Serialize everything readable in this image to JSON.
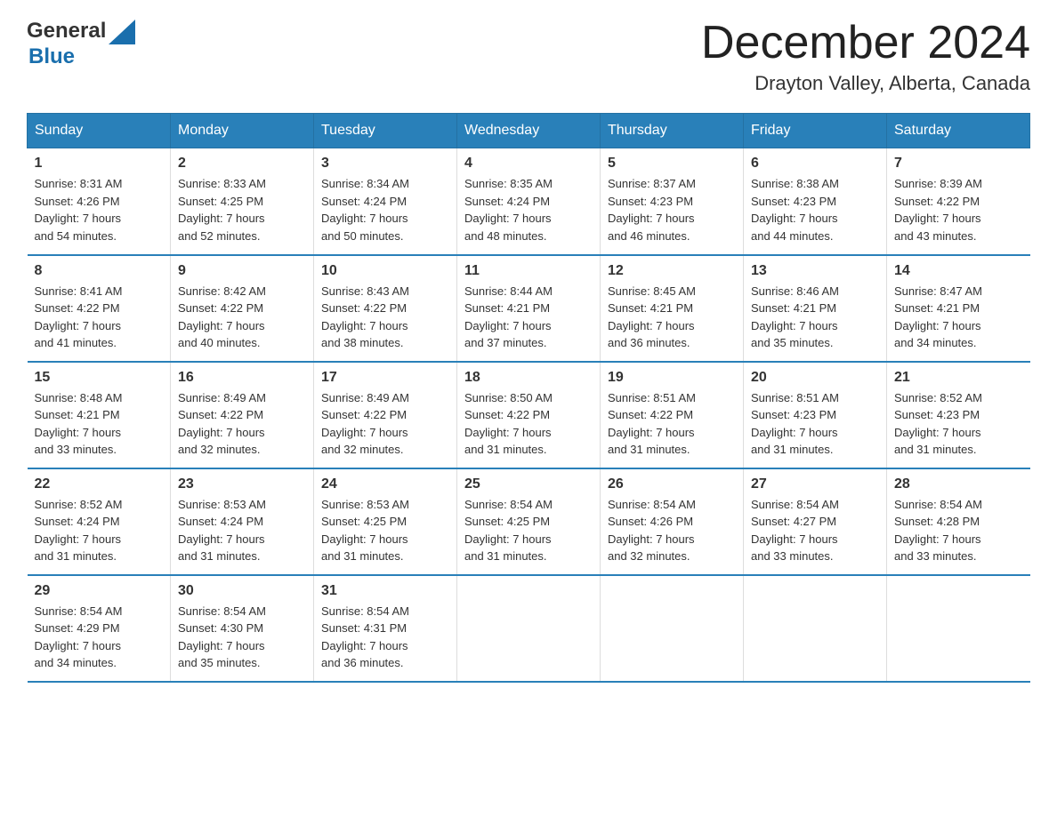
{
  "header": {
    "logo_general": "General",
    "logo_blue": "Blue",
    "month_title": "December 2024",
    "location": "Drayton Valley, Alberta, Canada"
  },
  "weekdays": [
    "Sunday",
    "Monday",
    "Tuesday",
    "Wednesday",
    "Thursday",
    "Friday",
    "Saturday"
  ],
  "weeks": [
    [
      {
        "day": "1",
        "sunrise": "8:31 AM",
        "sunset": "4:26 PM",
        "daylight": "7 hours and 54 minutes."
      },
      {
        "day": "2",
        "sunrise": "8:33 AM",
        "sunset": "4:25 PM",
        "daylight": "7 hours and 52 minutes."
      },
      {
        "day": "3",
        "sunrise": "8:34 AM",
        "sunset": "4:24 PM",
        "daylight": "7 hours and 50 minutes."
      },
      {
        "day": "4",
        "sunrise": "8:35 AM",
        "sunset": "4:24 PM",
        "daylight": "7 hours and 48 minutes."
      },
      {
        "day": "5",
        "sunrise": "8:37 AM",
        "sunset": "4:23 PM",
        "daylight": "7 hours and 46 minutes."
      },
      {
        "day": "6",
        "sunrise": "8:38 AM",
        "sunset": "4:23 PM",
        "daylight": "7 hours and 44 minutes."
      },
      {
        "day": "7",
        "sunrise": "8:39 AM",
        "sunset": "4:22 PM",
        "daylight": "7 hours and 43 minutes."
      }
    ],
    [
      {
        "day": "8",
        "sunrise": "8:41 AM",
        "sunset": "4:22 PM",
        "daylight": "7 hours and 41 minutes."
      },
      {
        "day": "9",
        "sunrise": "8:42 AM",
        "sunset": "4:22 PM",
        "daylight": "7 hours and 40 minutes."
      },
      {
        "day": "10",
        "sunrise": "8:43 AM",
        "sunset": "4:22 PM",
        "daylight": "7 hours and 38 minutes."
      },
      {
        "day": "11",
        "sunrise": "8:44 AM",
        "sunset": "4:21 PM",
        "daylight": "7 hours and 37 minutes."
      },
      {
        "day": "12",
        "sunrise": "8:45 AM",
        "sunset": "4:21 PM",
        "daylight": "7 hours and 36 minutes."
      },
      {
        "day": "13",
        "sunrise": "8:46 AM",
        "sunset": "4:21 PM",
        "daylight": "7 hours and 35 minutes."
      },
      {
        "day": "14",
        "sunrise": "8:47 AM",
        "sunset": "4:21 PM",
        "daylight": "7 hours and 34 minutes."
      }
    ],
    [
      {
        "day": "15",
        "sunrise": "8:48 AM",
        "sunset": "4:21 PM",
        "daylight": "7 hours and 33 minutes."
      },
      {
        "day": "16",
        "sunrise": "8:49 AM",
        "sunset": "4:22 PM",
        "daylight": "7 hours and 32 minutes."
      },
      {
        "day": "17",
        "sunrise": "8:49 AM",
        "sunset": "4:22 PM",
        "daylight": "7 hours and 32 minutes."
      },
      {
        "day": "18",
        "sunrise": "8:50 AM",
        "sunset": "4:22 PM",
        "daylight": "7 hours and 31 minutes."
      },
      {
        "day": "19",
        "sunrise": "8:51 AM",
        "sunset": "4:22 PM",
        "daylight": "7 hours and 31 minutes."
      },
      {
        "day": "20",
        "sunrise": "8:51 AM",
        "sunset": "4:23 PM",
        "daylight": "7 hours and 31 minutes."
      },
      {
        "day": "21",
        "sunrise": "8:52 AM",
        "sunset": "4:23 PM",
        "daylight": "7 hours and 31 minutes."
      }
    ],
    [
      {
        "day": "22",
        "sunrise": "8:52 AM",
        "sunset": "4:24 PM",
        "daylight": "7 hours and 31 minutes."
      },
      {
        "day": "23",
        "sunrise": "8:53 AM",
        "sunset": "4:24 PM",
        "daylight": "7 hours and 31 minutes."
      },
      {
        "day": "24",
        "sunrise": "8:53 AM",
        "sunset": "4:25 PM",
        "daylight": "7 hours and 31 minutes."
      },
      {
        "day": "25",
        "sunrise": "8:54 AM",
        "sunset": "4:25 PM",
        "daylight": "7 hours and 31 minutes."
      },
      {
        "day": "26",
        "sunrise": "8:54 AM",
        "sunset": "4:26 PM",
        "daylight": "7 hours and 32 minutes."
      },
      {
        "day": "27",
        "sunrise": "8:54 AM",
        "sunset": "4:27 PM",
        "daylight": "7 hours and 33 minutes."
      },
      {
        "day": "28",
        "sunrise": "8:54 AM",
        "sunset": "4:28 PM",
        "daylight": "7 hours and 33 minutes."
      }
    ],
    [
      {
        "day": "29",
        "sunrise": "8:54 AM",
        "sunset": "4:29 PM",
        "daylight": "7 hours and 34 minutes."
      },
      {
        "day": "30",
        "sunrise": "8:54 AM",
        "sunset": "4:30 PM",
        "daylight": "7 hours and 35 minutes."
      },
      {
        "day": "31",
        "sunrise": "8:54 AM",
        "sunset": "4:31 PM",
        "daylight": "7 hours and 36 minutes."
      },
      null,
      null,
      null,
      null
    ]
  ],
  "labels": {
    "sunrise": "Sunrise:",
    "sunset": "Sunset:",
    "daylight": "Daylight:"
  }
}
